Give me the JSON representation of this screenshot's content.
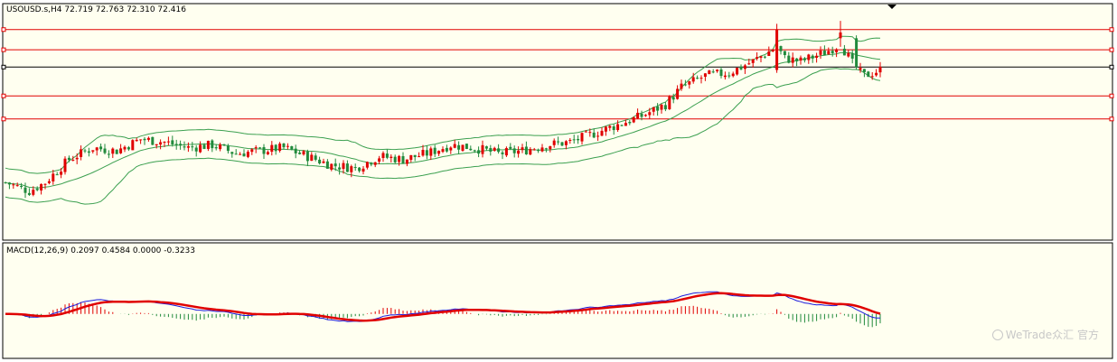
{
  "chart_data": [
    {
      "type": "candlestick",
      "symbol_header": "USOUSD.s,H4  72.719 72.763 72.310 72.416",
      "price_range": [
        67.6,
        75.8
      ],
      "horizontal_levels": [
        74.9,
        74.2,
        73.6,
        72.6,
        71.8
      ],
      "level_colors": [
        "#e00000",
        "#e00000",
        "#000000",
        "#e00000",
        "#e00000"
      ],
      "candles": [],
      "bollinger_period": 20,
      "bollinger_dev": 2,
      "colors": {
        "bull": "#e00000",
        "bear": "#218a3c",
        "band": "#3ca050"
      }
    },
    {
      "type": "macd",
      "header": "MACD(12,26,9) 0.2097 0.4584 0.0000 -0.3233",
      "value_range": [
        -1.0,
        1.6
      ],
      "colors": {
        "macd": "#1a1adc",
        "signal": "#e00000",
        "hist_pos": "#e00000",
        "hist_neg": "#218a3c"
      }
    }
  ],
  "watermark": {
    "text": "WeTrade众汇 官方",
    "icon": "wetrade-logo-icon"
  },
  "marker": {
    "icon": "shift-marker-icon"
  }
}
